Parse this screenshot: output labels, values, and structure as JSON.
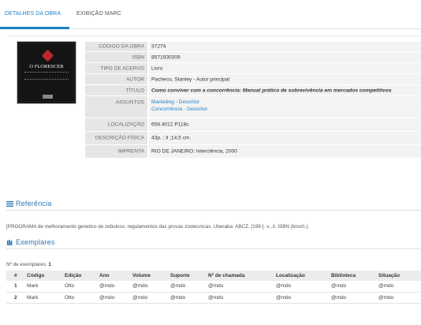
{
  "tabs": [
    {
      "label": "DETALHES DA OBRA",
      "active": true
    },
    {
      "label": "EXIBIÇÃO MARC",
      "active": false
    }
  ],
  "cover": {
    "title": "O FLORESCER"
  },
  "details": [
    {
      "label": "CÓDIGO DA OBRA",
      "value": "37274"
    },
    {
      "label": "ISBN",
      "value": "8571930309"
    },
    {
      "label": "TIPO DE ACERVO",
      "value": "Livro"
    },
    {
      "label": "AUTOR",
      "value": "Pacheco, Stanley - Autor principal"
    },
    {
      "label": "TÍTULO",
      "value": "Como conviver com a concorrência: Manual prático de sobrevivência em mercados competitivos"
    },
    {
      "label": "ASSUNTOS",
      "values": [
        "Marketing - Descritor",
        "Concorrência - Descritor"
      ]
    },
    {
      "label": "LOCALIZAÇÃO",
      "value": "658.4012 P118c"
    },
    {
      "label": "DESCRIÇÃO FÍSICA",
      "value": "43p. ; il ;14,5 cm."
    },
    {
      "label": "IMPRENTA",
      "value": "RIO DE JANEIRO: Interciência, 2000"
    }
  ],
  "referencia": {
    "title": "Referência",
    "icon": "list-icon",
    "text": "[PROGRAMA de melhoramento genetico de zebuinos: regulamentos das provas zootecnicas. Uberaba: ABCZ, [199-]. v., il. ISBN (broch.)."
  },
  "exemplares": {
    "title": "Exemplares",
    "icon": "books-icon",
    "count_label": "Nº de exemplares:",
    "count": "1",
    "columns": [
      "#",
      "Código",
      "Edição",
      "Ano",
      "Volume",
      "Suporte",
      "Nº de chamada",
      "Localização",
      "Biblioteca",
      "Situação"
    ],
    "rows": [
      [
        "1",
        "Mark",
        "Otto",
        "@mdo",
        "@mdo",
        "@mdo",
        "@mdo",
        "@mdo",
        "@mdo",
        "@mdo"
      ],
      [
        "2",
        "Mark",
        "Otto",
        "@mdo",
        "@mdo",
        "@mdo",
        "@mdo",
        "@mdo",
        "@mdo",
        "@mdo"
      ]
    ]
  },
  "colors": {
    "accent": "#1e7fc6",
    "label_bg": "#e6e6e6",
    "value_bg": "#f3f3f3"
  }
}
